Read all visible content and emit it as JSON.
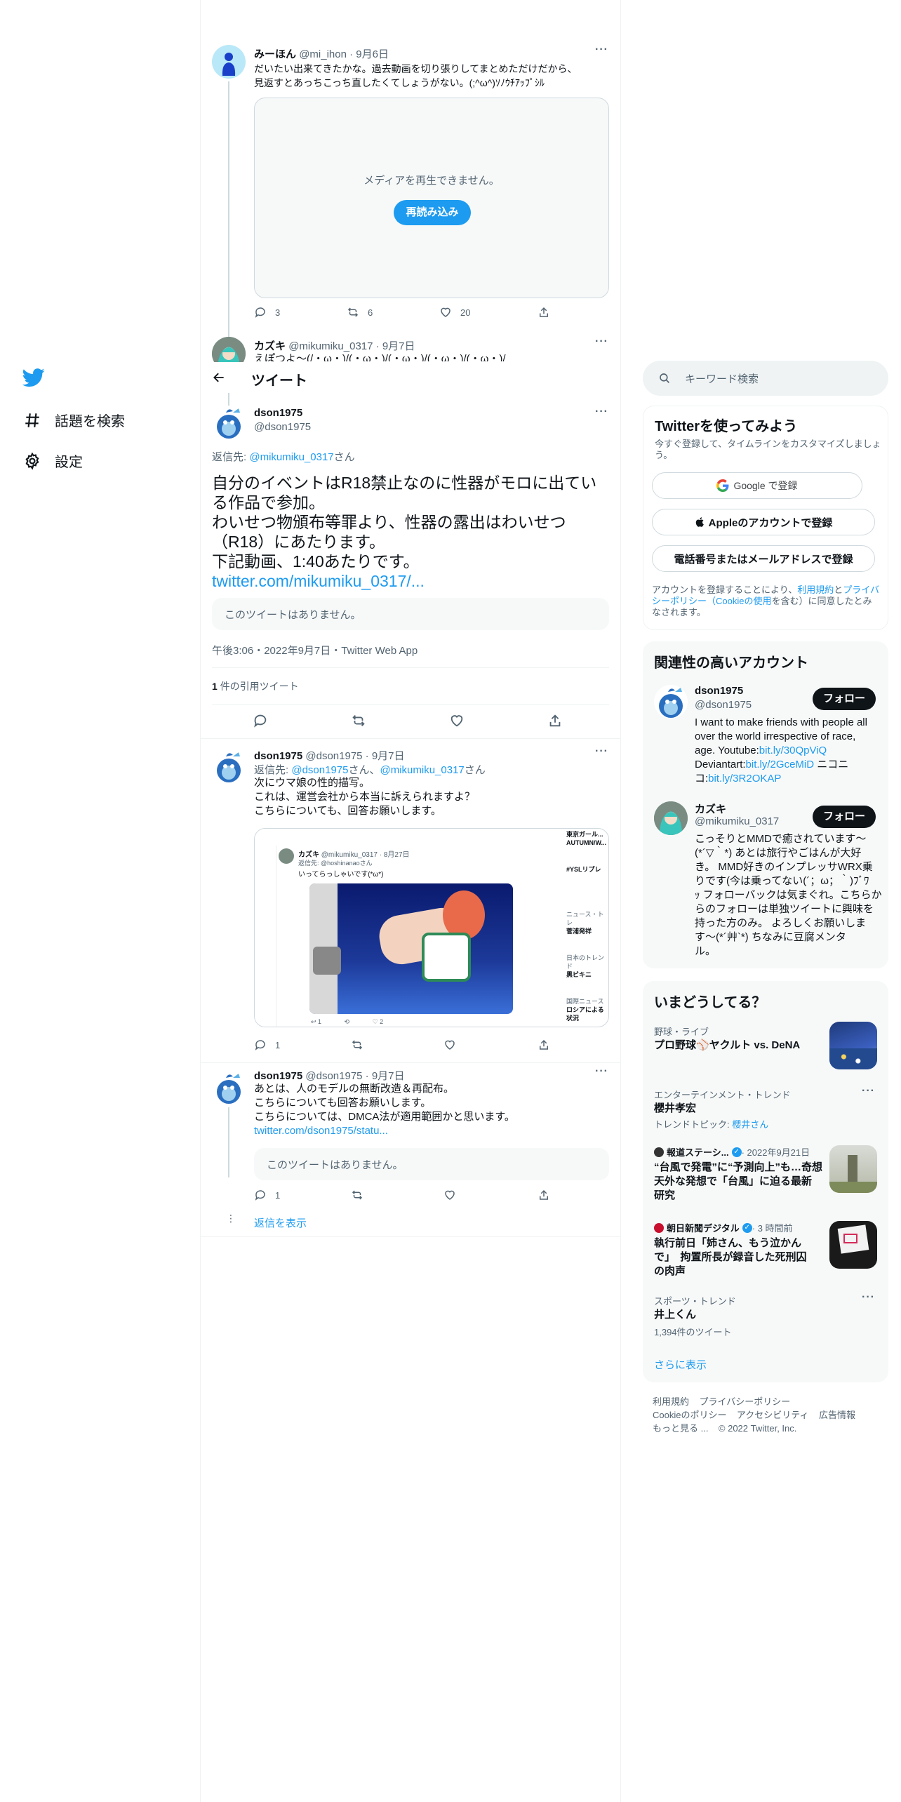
{
  "nav": {
    "explore": "話題を検索",
    "settings": "設定"
  },
  "header": {
    "title": "ツイート"
  },
  "tweet_prev1": {
    "name": "みーほん",
    "handle": "@mi_ihon",
    "time": "9月6日",
    "text1": "だいたい出来てきたかな。過去動画を切り張りしてまとめただけだから、",
    "text2": "見返すとあっちこっち直したくてしょうがない。(;^ω^)ｿﾉｳﾁｱｯﾌﾟｼﾙ",
    "media_error": "メディアを再生できません。",
    "reload": "再読み込み",
    "replies": "3",
    "retweets": "6",
    "likes": "20"
  },
  "tweet_prev2": {
    "name": "カズキ",
    "handle": "@mikumiku_0317",
    "time": "9月7日",
    "text": "えぽつよ～(/・ω・)/(・ω・)/(・ω・)/(・ω・)/(・ω・)/"
  },
  "main_tweet": {
    "name": "dson1975",
    "handle": "@dson1975",
    "reply_to_prefix": "返信先: ",
    "reply_to_user": "@mikumiku_0317",
    "reply_to_suffix": "さん",
    "line1": "自分のイベントはR18禁止なのに性器がモロに出てい",
    "line2": "る作品で参加。",
    "line3": "わいせつ物頒布等罪より、性器の露出はわいせつ",
    "line4": "（R18）にあたります。",
    "line5": "下記動画、1:40あたりです。",
    "link": "twitter.com/mikumiku_0317/...",
    "unavailable": "このツイートはありません。",
    "meta": "午後3:06・2022年9月7日・Twitter Web App",
    "quote_count": "1",
    "quote_label": " 件の引用ツイート"
  },
  "reply1": {
    "name": "dson1975",
    "handle": "@dson1975",
    "time": "9月7日",
    "reply_prefix": "返信先: ",
    "reply_user1": "@dson1975",
    "reply_mid": "さん、",
    "reply_user2": "@mikumiku_0317",
    "reply_suffix": "さん",
    "text1": "次にウマ娘の性的描写。",
    "text2": "これは、運営会社から本当に訴えられますよ？",
    "text3": "こちらについても、回答お願いします。",
    "replies": "1",
    "embedded": {
      "name": "カズキ",
      "handle": "@mikumiku_0317 · 8月27日",
      "reply": "返信先: @hoshinanaoさん",
      "text": "いってらっしゃいです(*ω*)",
      "side1": "東京ガール...",
      "side2": "AUTUMN/W...",
      "side3": "#YSLリプレ",
      "side4": "ニュース・トレ",
      "side5": "菅浦発祥",
      "side6": "日本のトレンド",
      "side7": "黒ビキニ",
      "side8": "国際ニュース",
      "side9": "ロシアによる",
      "side10": "状況"
    }
  },
  "reply2": {
    "name": "dson1975",
    "handle": "@dson1975",
    "time": "9月7日",
    "text1": "あとは、人のモデルの無断改造＆再配布。",
    "text2": "こちらについても回答お願いします。",
    "text3": "こちらについては、DMCA法が適用範囲かと思います。",
    "link": "twitter.com/dson1975/statu...",
    "unavailable": "このツイートはありません。",
    "replies": "1",
    "show_replies": "返信を表示"
  },
  "search": {
    "placeholder": "キーワード検索"
  },
  "signup": {
    "title": "Twitterを使ってみよう",
    "desc1": "今すぐ登録して、タイムラインをカスタマイズしましょ",
    "desc2": "う。",
    "google": "Google で登録",
    "apple": "Appleのアカウントで登録",
    "phone": "電話番号またはメールアドレスで登録",
    "terms1": "アカウントを登録することにより、",
    "terms_link1": "利用規約",
    "terms_and": "と",
    "terms_link2": "プライバシーポリシー（Cookieの使用",
    "terms2": "を含む）に同意したとみなされます。"
  },
  "related": {
    "title": "関連性の高いアカウント",
    "follow": "フォロー",
    "acc1": {
      "name": "dson1975",
      "handle": "@dson1975",
      "bio1": "I want to make friends with people all",
      "bio2": "over the world irrespective of race,",
      "bio3": "age. Youtube:",
      "bio3link": "bit.ly/30QpViQ",
      "bio4": "Deviantart:",
      "bio4link": "bit.ly/2GceMiD",
      "bio4b": " ニコニ",
      "bio5": "コ:",
      "bio5link": "bit.ly/3R2OKAP"
    },
    "acc2": {
      "name": "カズキ",
      "handle": "@mikumiku_0317",
      "bio1": "こっそりとMMDで癒されています～",
      "bio2": "(*´▽｀*) あとは旅行やごはんが大好",
      "bio3": "き。 MMD好きのインプレッサWRX乗",
      "bio4": "りです(今は乗ってない(´；ω；｀)ﾌﾞﾜ",
      "bio5": "ｯ フォローバックは気まぐれ。こちらか",
      "bio6": "らのフォローは単独ツイートに興味を",
      "bio7": "持った方のみ。 よろしくお願いしま",
      "bio8": "す～(*´艸`*) ちなみに豆腐メンタ",
      "bio9": "ル。"
    }
  },
  "trends": {
    "title": "いまどうしてる？",
    "t1_cat": "野球・ライブ",
    "t1_name": "プロ野球⚾ヤクルト vs. DeNA",
    "t2_cat": "エンターテインメント・トレンド",
    "t2_name": "櫻井孝宏",
    "t2_topic_prefix": "トレンドトピック: ",
    "t2_topic": "櫻井さん",
    "t3_src": "報道ステーシ...",
    "t3_time": " · 2022年9月21日",
    "t3_1": "“台風で発電”に“予測向上”も…奇想",
    "t3_2": "天外な発想で「台風」に迫る最新",
    "t3_3": "研究",
    "t4_src": "朝日新聞デジタル",
    "t4_time": " · 3 時間前",
    "t4_1": "執行前日「姉さん、もう泣かん",
    "t4_2": "で」　拘置所長が録音した死刑囚",
    "t4_3": "の肉声",
    "t5_cat": "スポーツ・トレンド",
    "t5_name": "井上くん",
    "t5_count": "1,394件のツイート",
    "more": "さらに表示"
  },
  "footer": {
    "terms": "利用規約",
    "privacy": "プライバシーポリシー",
    "cookie": "Cookieのポリシー",
    "access": "アクセシビリティ",
    "ads": "広告情報",
    "more": "もっと見る ...",
    "copy": "© 2022 Twitter, Inc."
  },
  "colors": {
    "accent": "#1d9bf0",
    "text": "#0f1419",
    "muted": "#536471",
    "border": "#eff3f4"
  }
}
